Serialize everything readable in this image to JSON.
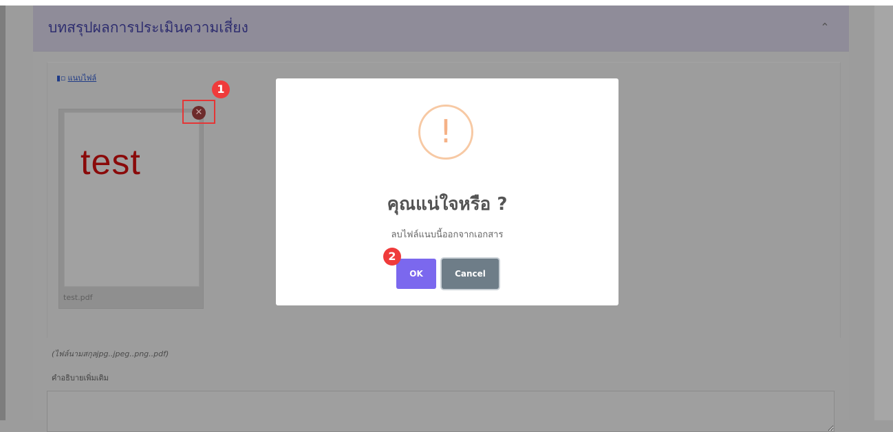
{
  "panel": {
    "title": "บทสรุปผลการประเมินความเสี่ยง",
    "collapse_icon": "chevron-up-icon"
  },
  "attachment": {
    "link_label": "แนบไฟล์",
    "link_icon": "file-icon",
    "thumbnail_text": "test",
    "filename": "test.pdf",
    "remove_icon": "close-circle-icon",
    "helper_note": "(ไฟล์นามสกุลjpg..jpeg..png..pdf)"
  },
  "description": {
    "label": "คำอธิบายเพิ่มเติม",
    "value": ""
  },
  "step_badges": [
    "1",
    "2"
  ],
  "dialog": {
    "icon": "warning-icon",
    "icon_glyph": "!",
    "title": "คุณแน่ใจหรือ ?",
    "message": "ลบไฟล์แนบนี้ออกจากเอกสาร",
    "ok_label": "OK",
    "cancel_label": "Cancel"
  },
  "colors": {
    "ok_button": "#7b68ee",
    "cancel_button": "#6e7d88",
    "warning": "#f5b287",
    "badge": "#ef3b3b",
    "highlight_box": "#e53535"
  }
}
